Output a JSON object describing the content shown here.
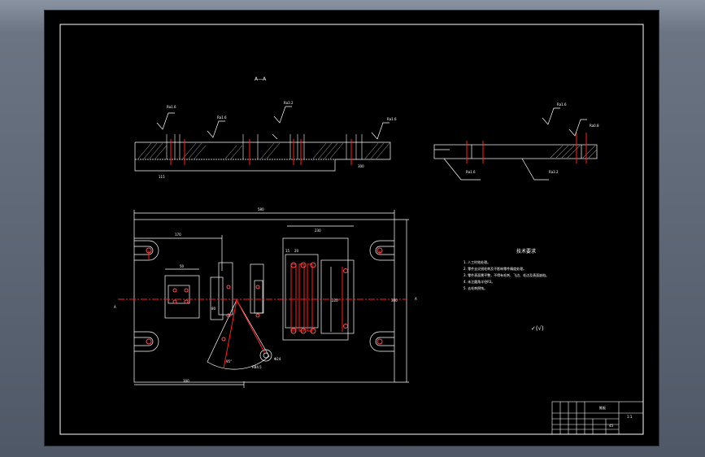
{
  "drawing": {
    "section_title": "A—A",
    "side_label_left": "A",
    "side_label_right": "A",
    "roughness_values": [
      "Ra1.6",
      "Ra1.6",
      "Ra1.6",
      "Ra3.2",
      "Ra1.6",
      "Ra0.8",
      "Ra1.6",
      "Ra3.2"
    ],
    "dimensions": {
      "overall_width": "580",
      "left_offset": "170",
      "section_left": "115",
      "section_right": "300",
      "right_block_width": "230",
      "bottom_width": "300",
      "overall_height": "300",
      "inner_height": "220",
      "hole_diam": "Φ24",
      "small_dim": "80",
      "angle_dim": "95°",
      "arc_dim": "R84.5",
      "dim_15": "15",
      "dim_20": "20",
      "dim_50": "50"
    },
    "notes": {
      "title": "技术要求",
      "items": [
        "1. 人工时效处理。",
        "2. 零件去尖锐毛刺及不影响零件精度处理。",
        "3. 零件表面需平整，不得有毛刺、飞边、毛边及表面缺陷。",
        "4. 未注圆角半径R3。",
        "5. 去毛刺倒钝。"
      ],
      "roughness_other": "✓(√)"
    },
    "title_block": {
      "part_name": "推板",
      "material": "45",
      "drawing_no": "1:1"
    }
  }
}
